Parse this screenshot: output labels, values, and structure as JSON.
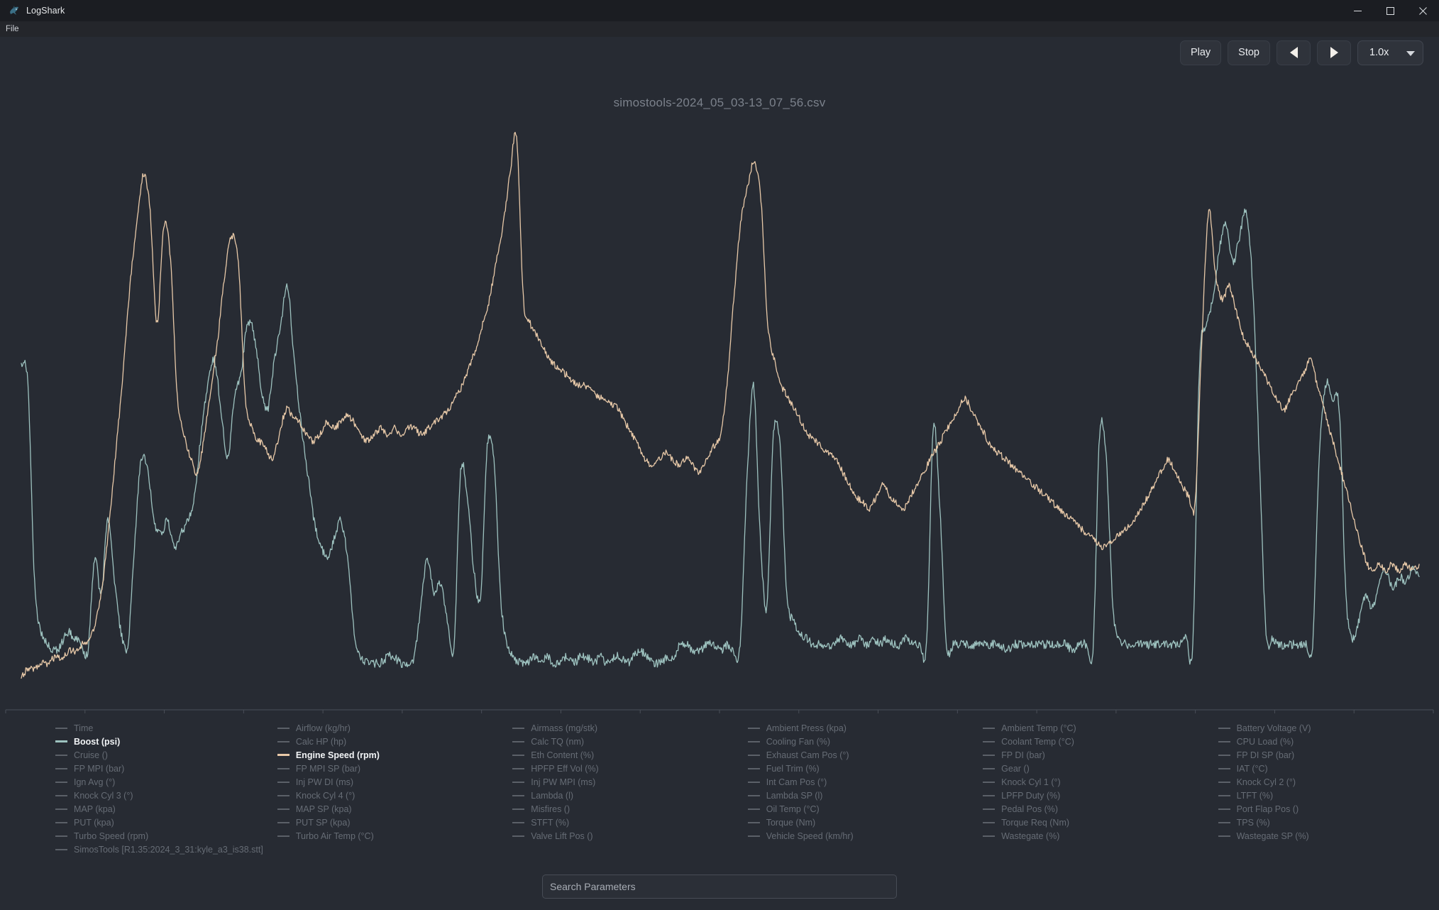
{
  "window": {
    "app_title": "LogShark",
    "app_icon": "shark-icon",
    "controls": {
      "minimize": "minimize-icon",
      "maximize": "maximize-icon",
      "close": "close-icon"
    }
  },
  "menubar": {
    "items": [
      {
        "label": "File"
      }
    ]
  },
  "toolbar": {
    "play_label": "Play",
    "stop_label": "Stop",
    "prev_icon": "play-back-icon",
    "next_icon": "play-forward-icon",
    "speed_value": "1.0x",
    "speed_caret": "chevron-down-icon"
  },
  "chart": {
    "title": "simostools-2024_05_03-13_07_56.csv"
  },
  "search": {
    "placeholder": "Search Parameters",
    "value": ""
  },
  "colors": {
    "background": "#272b33",
    "titlebar": "#1b1d22",
    "menubar": "#24262b",
    "boost_line": "#9dc2bf",
    "engine_speed_line": "#e8c9a8",
    "inactive_legend": "#666c75",
    "active_legend": "#f2f4f6",
    "axis": "#4a4f58"
  },
  "legend": {
    "columns": [
      {
        "items": [
          {
            "label": "Time",
            "active": false,
            "color": "#5b6068"
          },
          {
            "label": "Boost (psi)",
            "active": true,
            "color": "#9dc2bf"
          },
          {
            "label": "Cruise ()",
            "active": false,
            "color": "#5b6068"
          },
          {
            "label": "FP MPI (bar)",
            "active": false,
            "color": "#5b6068"
          },
          {
            "label": "Ign Avg (°)",
            "active": false,
            "color": "#5b6068"
          },
          {
            "label": "Knock Cyl 3 (°)",
            "active": false,
            "color": "#5b6068"
          },
          {
            "label": "MAP (kpa)",
            "active": false,
            "color": "#5b6068"
          },
          {
            "label": "PUT (kpa)",
            "active": false,
            "color": "#5b6068"
          },
          {
            "label": "Turbo Speed (rpm)",
            "active": false,
            "color": "#5b6068"
          },
          {
            "label": "SimosTools [R1.35:2024_3_31:kyle_a3_is38.stt]",
            "active": false,
            "color": "#5b6068"
          }
        ]
      },
      {
        "items": [
          {
            "label": "Airflow (kg/hr)",
            "active": false,
            "color": "#5b6068"
          },
          {
            "label": "Calc HP (hp)",
            "active": false,
            "color": "#5b6068"
          },
          {
            "label": "Engine Speed (rpm)",
            "active": true,
            "color": "#e8c9a8"
          },
          {
            "label": "FP MPI SP (bar)",
            "active": false,
            "color": "#5b6068"
          },
          {
            "label": "Inj PW DI (ms)",
            "active": false,
            "color": "#5b6068"
          },
          {
            "label": "Knock Cyl 4 (°)",
            "active": false,
            "color": "#5b6068"
          },
          {
            "label": "MAP SP (kpa)",
            "active": false,
            "color": "#5b6068"
          },
          {
            "label": "PUT SP (kpa)",
            "active": false,
            "color": "#5b6068"
          },
          {
            "label": "Turbo Air Temp (°C)",
            "active": false,
            "color": "#5b6068"
          }
        ]
      },
      {
        "items": [
          {
            "label": "Airmass (mg/stk)",
            "active": false,
            "color": "#5b6068"
          },
          {
            "label": "Calc TQ (nm)",
            "active": false,
            "color": "#5b6068"
          },
          {
            "label": "Eth Content (%)",
            "active": false,
            "color": "#5b6068"
          },
          {
            "label": "HPFP Eff Vol (%)",
            "active": false,
            "color": "#5b6068"
          },
          {
            "label": "Inj PW MPI (ms)",
            "active": false,
            "color": "#5b6068"
          },
          {
            "label": "Lambda (l)",
            "active": false,
            "color": "#5b6068"
          },
          {
            "label": "Misfires ()",
            "active": false,
            "color": "#5b6068"
          },
          {
            "label": "STFT (%)",
            "active": false,
            "color": "#5b6068"
          },
          {
            "label": "Valve Lift Pos ()",
            "active": false,
            "color": "#5b6068"
          }
        ]
      },
      {
        "items": [
          {
            "label": "Ambient Press (kpa)",
            "active": false,
            "color": "#5b6068"
          },
          {
            "label": "Cooling Fan (%)",
            "active": false,
            "color": "#5b6068"
          },
          {
            "label": "Exhaust Cam Pos (°)",
            "active": false,
            "color": "#5b6068"
          },
          {
            "label": "Fuel Trim (%)",
            "active": false,
            "color": "#5b6068"
          },
          {
            "label": "Int Cam Pos (°)",
            "active": false,
            "color": "#5b6068"
          },
          {
            "label": "Lambda SP (l)",
            "active": false,
            "color": "#5b6068"
          },
          {
            "label": "Oil Temp (°C)",
            "active": false,
            "color": "#5b6068"
          },
          {
            "label": "Torque (Nm)",
            "active": false,
            "color": "#5b6068"
          },
          {
            "label": "Vehicle Speed (km/hr)",
            "active": false,
            "color": "#5b6068"
          }
        ]
      },
      {
        "items": [
          {
            "label": "Ambient Temp (°C)",
            "active": false,
            "color": "#5b6068"
          },
          {
            "label": "Coolant Temp (°C)",
            "active": false,
            "color": "#5b6068"
          },
          {
            "label": "FP DI (bar)",
            "active": false,
            "color": "#5b6068"
          },
          {
            "label": "Gear ()",
            "active": false,
            "color": "#5b6068"
          },
          {
            "label": "Knock Cyl 1 (°)",
            "active": false,
            "color": "#5b6068"
          },
          {
            "label": "LPFP Duty (%)",
            "active": false,
            "color": "#5b6068"
          },
          {
            "label": "Pedal Pos (%)",
            "active": false,
            "color": "#5b6068"
          },
          {
            "label": "Torque Req (Nm)",
            "active": false,
            "color": "#5b6068"
          },
          {
            "label": "Wastegate (%)",
            "active": false,
            "color": "#5b6068"
          }
        ]
      },
      {
        "items": [
          {
            "label": "Battery Voltage (V)",
            "active": false,
            "color": "#5b6068"
          },
          {
            "label": "CPU Load (%)",
            "active": false,
            "color": "#5b6068"
          },
          {
            "label": "FP DI SP (bar)",
            "active": false,
            "color": "#5b6068"
          },
          {
            "label": "IAT (°C)",
            "active": false,
            "color": "#5b6068"
          },
          {
            "label": "Knock Cyl 2 (°)",
            "active": false,
            "color": "#5b6068"
          },
          {
            "label": "LTFT (%)",
            "active": false,
            "color": "#5b6068"
          },
          {
            "label": "Port Flap Pos ()",
            "active": false,
            "color": "#5b6068"
          },
          {
            "label": "TPS (%)",
            "active": false,
            "color": "#5b6068"
          },
          {
            "label": "Wastegate SP (%)",
            "active": false,
            "color": "#5b6068"
          }
        ]
      }
    ]
  },
  "chart_data": {
    "type": "line",
    "title": "simostools-2024_05_03-13_07_56.csv",
    "xlabel": "",
    "ylabel": "",
    "grid": false,
    "legend_position": "bottom",
    "axis_ticks_count": 19,
    "x": [
      0,
      1,
      2,
      3,
      4,
      5,
      6,
      7,
      8,
      9,
      10,
      11,
      12,
      13,
      14,
      15,
      16,
      17,
      18,
      19,
      20,
      21,
      22,
      23,
      24,
      25,
      26,
      27,
      28,
      29,
      30,
      31,
      32,
      33,
      34,
      35,
      36,
      37,
      38,
      39,
      40,
      41,
      42,
      43,
      44,
      45,
      46,
      47,
      48,
      49,
      50,
      51,
      52,
      53,
      54,
      55,
      56,
      57,
      58,
      59,
      60,
      61,
      62,
      63,
      64,
      65,
      66,
      67,
      68,
      69,
      70,
      71,
      72,
      73,
      74,
      75,
      76,
      77,
      78,
      79,
      80,
      81,
      82,
      83,
      84,
      85,
      86,
      87,
      88,
      89,
      90,
      91,
      92,
      93,
      94,
      95,
      96,
      97,
      98,
      99,
      100,
      101,
      102,
      103,
      104,
      105,
      106,
      107,
      108,
      109,
      110,
      111,
      112,
      113,
      114,
      115,
      116,
      117,
      118,
      119,
      120,
      121,
      122,
      123,
      124,
      125,
      126,
      127,
      128,
      129,
      130,
      131,
      132,
      133,
      134,
      135,
      136,
      137,
      138,
      139,
      140,
      141,
      142,
      143,
      144,
      145,
      146,
      147,
      148,
      149,
      150,
      151,
      152,
      153,
      154,
      155,
      156,
      157,
      158,
      159,
      160,
      161,
      162,
      163,
      164,
      165,
      166,
      167,
      168,
      169,
      170,
      171,
      172,
      173,
      174,
      175,
      176,
      177,
      178,
      179,
      180,
      181,
      182,
      183,
      184,
      185,
      186,
      187,
      188,
      189,
      190,
      191,
      192,
      193,
      194,
      195,
      196,
      197,
      198,
      199,
      200
    ],
    "series": [
      {
        "name": "Boost (psi)",
        "color": "#9dc2bf",
        "active": true,
        "values": [
          55,
          52,
          20,
          12,
          10,
          9,
          10,
          12,
          11,
          10,
          9,
          24,
          18,
          30,
          20,
          12,
          10,
          26,
          40,
          38,
          30,
          28,
          30,
          26,
          28,
          30,
          34,
          44,
          52,
          56,
          48,
          40,
          50,
          54,
          62,
          60,
          52,
          48,
          56,
          62,
          68,
          56,
          46,
          38,
          30,
          26,
          24,
          27,
          30,
          24,
          12,
          8,
          7,
          7,
          7,
          8,
          8,
          7,
          7,
          8,
          16,
          24,
          18,
          20,
          14,
          10,
          38,
          34,
          22,
          18,
          42,
          40,
          18,
          10,
          8,
          7,
          7,
          8,
          7,
          8,
          7,
          7,
          8,
          7,
          8,
          8,
          7,
          8,
          7,
          8,
          8,
          7,
          8,
          9,
          8,
          7,
          7,
          8,
          8,
          10,
          10,
          9,
          9,
          10,
          10,
          9,
          10,
          9,
          10,
          36,
          52,
          28,
          16,
          44,
          42,
          18,
          14,
          12,
          11,
          10,
          10,
          10,
          10,
          11,
          10,
          10,
          11,
          10,
          11,
          10,
          11,
          10,
          10,
          11,
          10,
          10,
          10,
          45,
          32,
          10,
          10,
          10,
          10,
          10,
          10,
          10,
          10,
          10,
          9,
          10,
          10,
          10,
          10,
          10,
          10,
          10,
          10,
          10,
          9,
          10,
          10,
          9,
          44,
          40,
          16,
          11,
          10,
          10,
          10,
          10,
          10,
          10,
          10,
          10,
          10,
          11,
          10,
          55,
          62,
          66,
          74,
          78,
          72,
          76,
          80,
          68,
          40,
          12,
          11,
          10,
          10,
          10,
          10,
          10,
          10,
          40,
          52,
          50,
          48,
          18,
          11,
          14,
          18,
          16,
          20,
          22,
          19,
          21,
          20,
          22,
          21
        ]
      },
      {
        "name": "Engine Speed (rpm)",
        "color": "#e8c9a8",
        "active": true,
        "values": [
          5,
          6,
          6,
          7,
          7,
          8,
          8,
          9,
          9,
          10,
          11,
          14,
          20,
          30,
          42,
          54,
          68,
          78,
          86,
          80,
          62,
          78,
          72,
          50,
          44,
          40,
          38,
          44,
          52,
          60,
          70,
          76,
          72,
          50,
          45,
          43,
          42,
          40,
          44,
          48,
          47,
          46,
          44,
          43,
          44,
          46,
          45,
          46,
          47,
          46,
          44,
          43,
          44,
          45,
          44,
          45,
          44,
          45,
          45,
          44,
          45,
          46,
          47,
          48,
          50,
          52,
          55,
          58,
          62,
          66,
          72,
          78,
          86,
          92,
          66,
          62,
          60,
          58,
          56,
          55,
          54,
          53,
          52,
          52,
          51,
          50,
          50,
          49,
          48,
          46,
          44,
          42,
          40,
          39,
          40,
          41,
          40,
          39,
          40,
          39,
          38,
          40,
          42,
          44,
          52,
          66,
          78,
          84,
          88,
          82,
          62,
          56,
          52,
          50,
          48,
          46,
          44,
          43,
          42,
          41,
          40,
          38,
          36,
          34,
          33,
          32,
          34,
          36,
          34,
          33,
          32,
          34,
          36,
          38,
          40,
          42,
          44,
          46,
          48,
          50,
          48,
          46,
          44,
          42,
          41,
          40,
          39,
          38,
          37,
          36,
          35,
          34,
          33,
          32,
          31,
          30,
          29,
          28,
          27,
          26,
          26,
          27,
          28,
          29,
          30,
          32,
          34,
          36,
          38,
          40,
          38,
          36,
          34,
          33,
          60,
          80,
          70,
          66,
          68,
          64,
          60,
          58,
          56,
          54,
          52,
          50,
          48,
          50,
          52,
          54,
          56,
          52,
          48,
          44,
          40,
          36,
          32,
          28,
          24,
          22,
          23,
          22,
          23,
          22,
          23,
          22,
          23
        ]
      }
    ]
  }
}
